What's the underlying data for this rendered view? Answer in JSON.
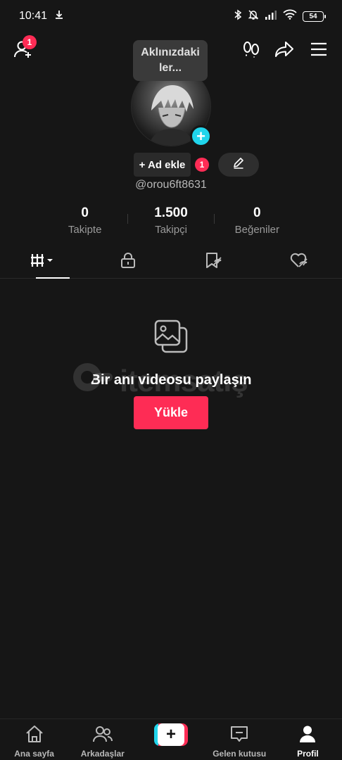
{
  "status_bar": {
    "time": "10:41",
    "battery": "54"
  },
  "header": {
    "friend_requests_badge": "1"
  },
  "profile": {
    "tooltip": "Aklınızdaki ler...",
    "add_name_label": "+ Ad ekle",
    "add_name_badge": "1",
    "username": "@orou6ft8631"
  },
  "stats": [
    {
      "value": "0",
      "label": "Takipte"
    },
    {
      "value": "1.500",
      "label": "Takipçi"
    },
    {
      "value": "0",
      "label": "Beğeniler"
    }
  ],
  "tabs": [
    {
      "icon": "grid-icon"
    },
    {
      "icon": "lock-icon"
    },
    {
      "icon": "bookmark-icon"
    },
    {
      "icon": "heart-icon"
    }
  ],
  "empty_state": {
    "title": "Bir anı videosu paylaşın",
    "button": "Yükle"
  },
  "watermark": "itemsatış",
  "bottom_nav": {
    "home": "Ana sayfa",
    "friends": "Arkadaşlar",
    "create": "+",
    "inbox": "Gelen kutusu",
    "profile": "Profil"
  },
  "colors": {
    "accent": "#fe2c55",
    "secondary": "#20d5ec",
    "background": "#161616"
  }
}
